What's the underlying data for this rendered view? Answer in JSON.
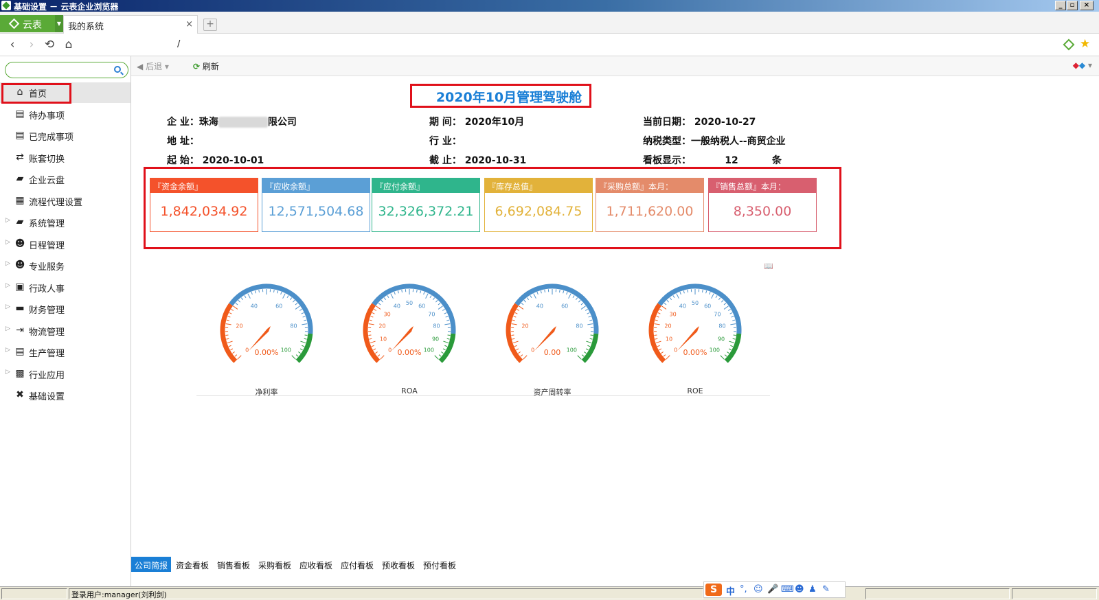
{
  "window": {
    "title": "基础设置 － 云表企业浏览器",
    "buttons": [
      "_",
      "▫",
      "×"
    ]
  },
  "tabbar": {
    "brand": "云表",
    "tab_label": "我的系统",
    "tab_close": "×",
    "new_tab": "+"
  },
  "navbar": {
    "url": "/"
  },
  "sidebar": {
    "search_placeholder": "",
    "items": [
      {
        "label": "首页",
        "icon": "home-icon"
      },
      {
        "label": "待办事项",
        "icon": "list-icon"
      },
      {
        "label": "已完成事项",
        "icon": "list-icon"
      },
      {
        "label": "账套切换",
        "icon": "switch-icon"
      },
      {
        "label": "企业云盘",
        "icon": "folder-icon"
      },
      {
        "label": "流程代理设置",
        "icon": "document-icon"
      },
      {
        "label": "系统管理",
        "icon": "folder-icon"
      },
      {
        "label": "日程管理",
        "icon": "user-icon"
      },
      {
        "label": "专业服务",
        "icon": "user-icon"
      },
      {
        "label": "行政人事",
        "icon": "id-card-icon"
      },
      {
        "label": "财务管理",
        "icon": "finance-icon"
      },
      {
        "label": "物流管理",
        "icon": "logistics-icon"
      },
      {
        "label": "生产管理",
        "icon": "production-icon"
      },
      {
        "label": "行业应用",
        "icon": "grid-icon"
      },
      {
        "label": "基础设置",
        "icon": "tools-icon"
      }
    ]
  },
  "toolbar": {
    "back_label": "后退",
    "refresh_label": "刷新"
  },
  "dashboard": {
    "title": "2020年10月管理驾驶舱",
    "info": {
      "company_label": "企 业：",
      "company_value_prefix": "珠海",
      "company_value_suffix": "限公司",
      "period_label": "期 间：",
      "period_value": "2020年10月",
      "current_date_label": "当前日期：",
      "current_date_value": "2020-10-27",
      "address_label": "地 址：",
      "address_value": "",
      "industry_label": "行 业：",
      "industry_value": "",
      "tax_type_label": "纳税类型：",
      "tax_type_value": "一般纳税人--商贸企业",
      "start_label": "起 始：",
      "start_value": "2020-10-01",
      "end_label": "截 止：",
      "end_value": "2020-10-31",
      "board_display_label": "看板显示：",
      "board_display_count": "12",
      "board_display_unit": "条"
    },
    "cards": [
      {
        "title": "『资金余额』",
        "value": "1,842,034.92",
        "color": "#f4522b"
      },
      {
        "title": "『应收余额』",
        "value": "12,571,504.68",
        "color": "#5b9fd6"
      },
      {
        "title": "『应付余额』",
        "value": "32,326,372.21",
        "color": "#2fb58c"
      },
      {
        "title": "『库存总值』",
        "value": "6,692,084.75",
        "color": "#e2b23a"
      },
      {
        "title": "『采购总额』本月：",
        "value": "1,711,620.00",
        "color": "#e48b6a"
      },
      {
        "title": "『销售总额』本月：",
        "value": "8,350.00",
        "color": "#d85f6f"
      }
    ],
    "gauges": [
      {
        "label": "净利率",
        "value_text": "0.00%",
        "ticks": [
          "0",
          "20",
          "40",
          "60",
          "80",
          "100"
        ]
      },
      {
        "label": "ROA",
        "value_text": "0.00%",
        "ticks": [
          "0",
          "10",
          "20",
          "30",
          "40",
          "50",
          "60",
          "70",
          "80",
          "90",
          "100"
        ]
      },
      {
        "label": "资产周转率",
        "value_text": "0.00",
        "ticks": [
          "0",
          "20",
          "40",
          "60",
          "80",
          "100"
        ]
      },
      {
        "label": "ROE",
        "value_text": "0.00%",
        "ticks": [
          "0",
          "10",
          "20",
          "30",
          "40",
          "50",
          "60",
          "70",
          "80",
          "90",
          "100"
        ]
      }
    ]
  },
  "bottom_tabs": [
    "公司简报",
    "资金看板",
    "销售看板",
    "采购看板",
    "应收看板",
    "应付看板",
    "预收看板",
    "预付看板"
  ],
  "statusbar": {
    "user_text": "登录用户:manager(刘利剑)"
  },
  "ime": {
    "logo": "S",
    "lang": "中"
  }
}
